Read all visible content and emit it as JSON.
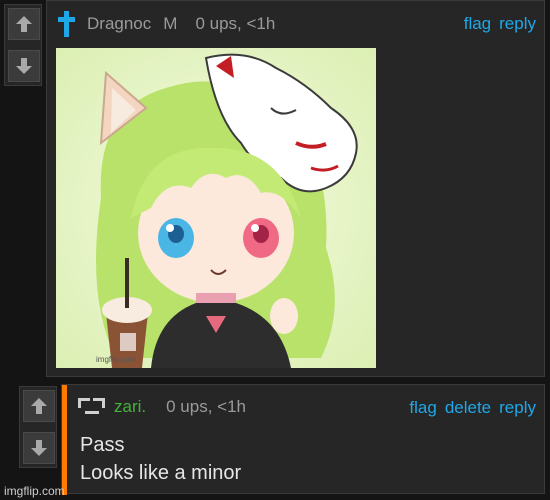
{
  "comment1": {
    "username": "Dragnoc",
    "gender": "M",
    "stats": "0 ups, <1h",
    "actions": {
      "flag": "flag",
      "reply": "reply"
    },
    "image_watermark": "imgflip.com",
    "icon": "cross-icon"
  },
  "comment2": {
    "username": "zari.",
    "stats": "0 ups, <1h",
    "actions": {
      "flag": "flag",
      "delete": "delete",
      "reply": "reply"
    },
    "body_line1": "Pass",
    "body_line2": "Looks like a minor",
    "icon": "glyph-avatar-icon"
  },
  "footer": {
    "watermark": "imgflip.com"
  },
  "colors": {
    "link": "#1ea8e8",
    "accent_bar": "#ff7a00",
    "username2": "#43b33b",
    "cross": "#1ea8e8"
  }
}
